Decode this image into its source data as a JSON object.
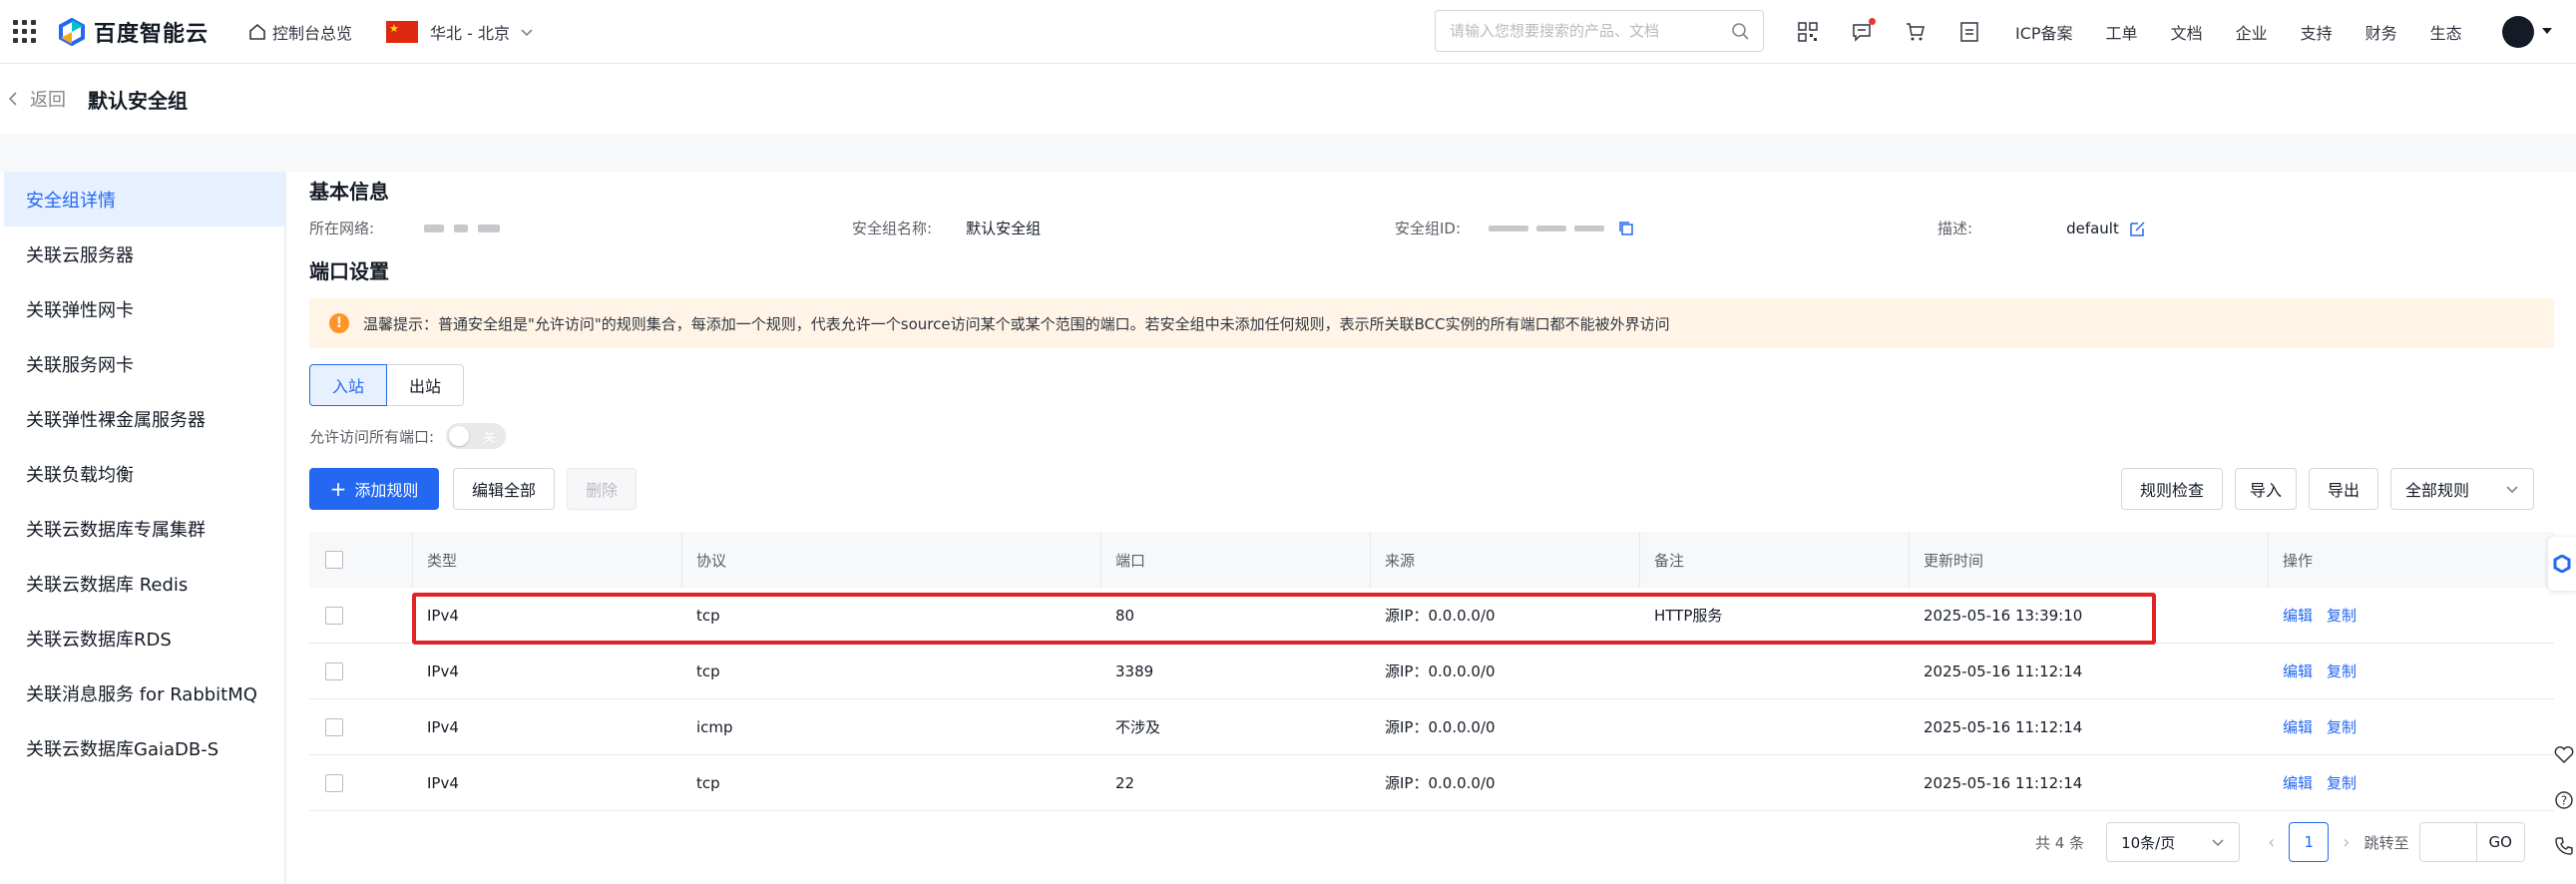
{
  "topbar": {
    "brand": "百度智能云",
    "console_home": "控制台总览",
    "region": "华北 - 北京",
    "search_placeholder": "请输入您想要搜索的产品、文档",
    "links": [
      "ICP备案",
      "工单",
      "文档",
      "企业",
      "支持",
      "财务",
      "生态"
    ]
  },
  "header": {
    "back": "返回",
    "title": "默认安全组"
  },
  "sidebar": {
    "items": [
      {
        "label": "安全组详情",
        "active": true
      },
      {
        "label": "关联云服务器"
      },
      {
        "label": "关联弹性网卡"
      },
      {
        "label": "关联服务网卡"
      },
      {
        "label": "关联弹性裸金属服务器"
      },
      {
        "label": "关联负载均衡"
      },
      {
        "label": "关联云数据库专属集群"
      },
      {
        "label": "关联云数据库 Redis"
      },
      {
        "label": "关联云数据库RDS"
      },
      {
        "label": "关联消息服务 for RabbitMQ"
      },
      {
        "label": "关联云数据库GaiaDB-S"
      }
    ]
  },
  "basic": {
    "title": "基本信息",
    "network_label": "所在网络:",
    "name_label": "安全组名称:",
    "name_value": "默认安全组",
    "id_label": "安全组ID:",
    "desc_label": "描述:",
    "desc_value": "default"
  },
  "ports": {
    "title": "端口设置",
    "notice": "温馨提示：普通安全组是\"允许访问\"的规则集合，每添加一个规则，代表允许一个source访问某个或某个范围的端口。若安全组中未添加任何规则，表示所关联BCC实例的所有端口都不能被外界访问",
    "tabs": [
      {
        "label": "入站",
        "active": true
      },
      {
        "label": "出站"
      }
    ],
    "allow_all_label": "允许访问所有端口:",
    "switch_label": "关",
    "buttons": {
      "add": "添加规则",
      "edit_all": "编辑全部",
      "delete": "删除",
      "check": "规则检查",
      "import": "导入",
      "export": "导出",
      "filter": "全部规则"
    }
  },
  "table": {
    "headers": [
      "类型",
      "协议",
      "端口",
      "来源",
      "备注",
      "更新时间",
      "操作"
    ],
    "rows": [
      {
        "type": "IPv4",
        "protocol": "tcp",
        "port": "80",
        "source": "源IP：0.0.0.0/0",
        "remark": "HTTP服务",
        "updated": "2025-05-16 13:39:10",
        "edit": "编辑",
        "copy": "复制"
      },
      {
        "type": "IPv4",
        "protocol": "tcp",
        "port": "3389",
        "source": "源IP：0.0.0.0/0",
        "remark": "",
        "updated": "2025-05-16 11:12:14",
        "edit": "编辑",
        "copy": "复制"
      },
      {
        "type": "IPv4",
        "protocol": "icmp",
        "port": "不涉及",
        "source": "源IP：0.0.0.0/0",
        "remark": "",
        "updated": "2025-05-16 11:12:14",
        "edit": "编辑",
        "copy": "复制"
      },
      {
        "type": "IPv4",
        "protocol": "tcp",
        "port": "22",
        "source": "源IP：0.0.0.0/0",
        "remark": "",
        "updated": "2025-05-16 11:12:14",
        "edit": "编辑",
        "copy": "复制"
      }
    ]
  },
  "pagination": {
    "total": "共 4 条",
    "page_size": "10条/页",
    "current": "1",
    "jump_label": "跳转至",
    "go": "GO"
  },
  "colors": {
    "primary": "#2468f2",
    "highlight": "#e02424",
    "notice_bg": "#fff4e6",
    "warning": "#ff9326"
  }
}
